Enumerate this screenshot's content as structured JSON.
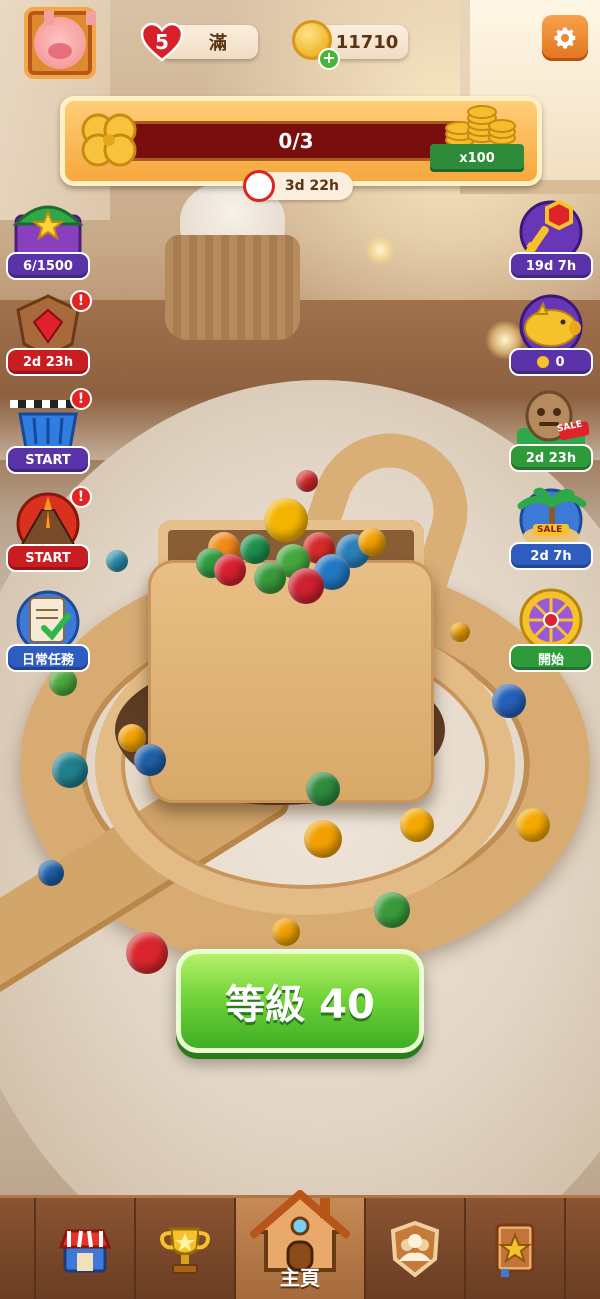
{
  "header": {
    "lives": {
      "count": "5",
      "status": "滿"
    },
    "coins": "11710"
  },
  "event": {
    "progress_text": "0/3",
    "progress_fraction": 0,
    "reward": "x100",
    "timer": "3d 22h"
  },
  "left_widgets": [
    {
      "name": "treasure-chest",
      "label": "6/1500",
      "color": "#5a33a8",
      "alert": false
    },
    {
      "name": "ruby-shield",
      "label": "2d 23h",
      "color": "#c81e22",
      "alert": true
    },
    {
      "name": "race-basket",
      "label": "START",
      "color": "#5a33a8",
      "alert": true
    },
    {
      "name": "volcano",
      "label": "START",
      "color": "#c81e22",
      "alert": true
    },
    {
      "name": "daily-tasks",
      "label": "日常任務",
      "color": "#2f5dbf",
      "alert": false
    }
  ],
  "right_widgets": [
    {
      "name": "key",
      "label": "19d 7h",
      "color": "#5a33a8"
    },
    {
      "name": "piggy-bank",
      "label": "0",
      "color": "#5a33a8"
    },
    {
      "name": "sale-idol",
      "label": "2d 23h",
      "color": "#2f9a3a",
      "badge": "SALE"
    },
    {
      "name": "island-sale",
      "label": "2d 7h",
      "color": "#2f5dbf",
      "badge": "SALE"
    },
    {
      "name": "lucky-wheel",
      "label": "開始",
      "color": "#2f9a3a"
    }
  ],
  "play_button": "等級 40",
  "nav": {
    "items": [
      {
        "name": "shop",
        "label": ""
      },
      {
        "name": "trophy",
        "label": ""
      },
      {
        "name": "home",
        "label": "主頁"
      },
      {
        "name": "team",
        "label": ""
      },
      {
        "name": "collection",
        "label": ""
      }
    ],
    "active": "home"
  }
}
